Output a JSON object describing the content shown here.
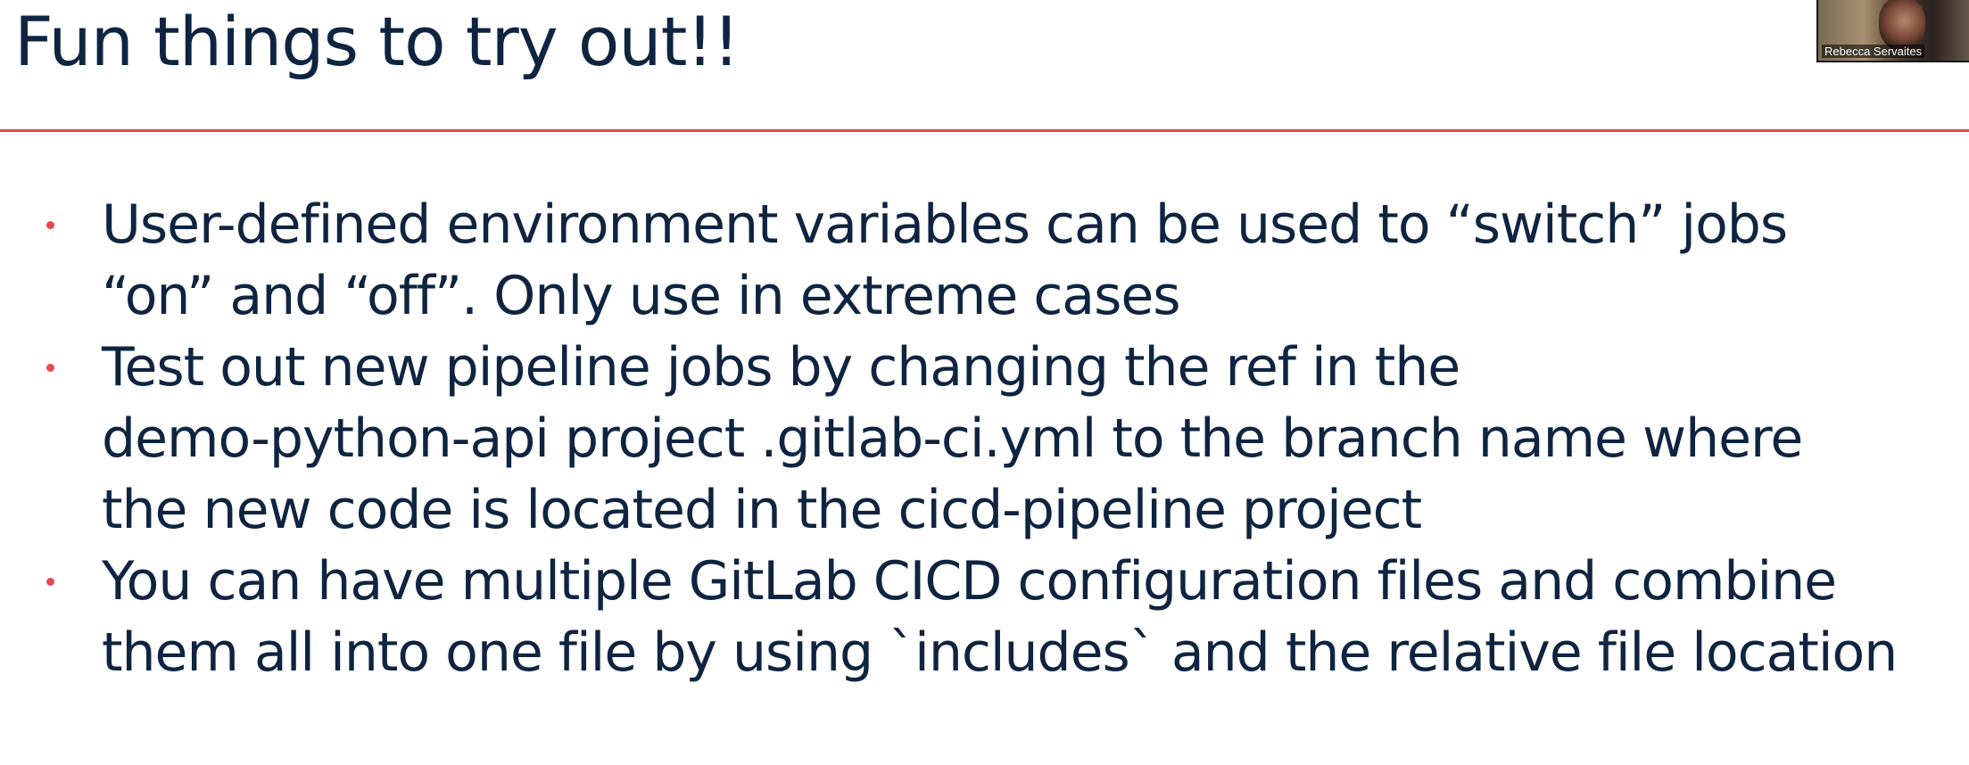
{
  "slide": {
    "title": "Fun things to try out!!",
    "bullets": [
      {
        "lines": [
          "User-defined environment variables can be used to “switch” jobs",
          "“on” and “off”. Only use in extreme cases"
        ]
      },
      {
        "lines": [
          "Test out new pipeline jobs by changing the ref in the",
          "demo-python-api project .gitlab-ci.yml to the branch name where",
          "the new code is located in the cicd-pipeline project"
        ]
      },
      {
        "lines": [
          "You can have multiple GitLab CICD configuration files and combine",
          "them all into one file by using `includes` and the relative file location"
        ]
      }
    ]
  },
  "video": {
    "participant_name": "Rebecca Servaites"
  },
  "colors": {
    "title_text": "#0f2440",
    "accent_rule": "#e8484f",
    "bullet_dot": "#e8484f"
  }
}
